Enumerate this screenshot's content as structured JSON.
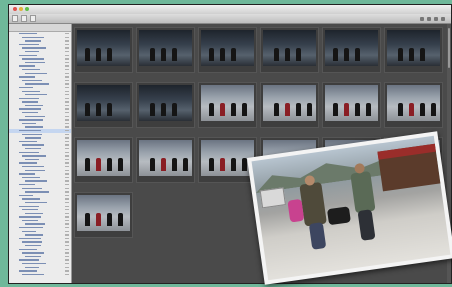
{
  "window": {
    "title": ""
  },
  "toolbar": {
    "buttons": [
      "",
      "",
      ""
    ]
  },
  "sidebar": {
    "header": "",
    "rows": 68,
    "selected_row": 27
  },
  "thumbnails": [
    {
      "kind": "dark",
      "caption": ""
    },
    {
      "kind": "dark",
      "caption": ""
    },
    {
      "kind": "dark",
      "caption": ""
    },
    {
      "kind": "dark",
      "caption": ""
    },
    {
      "kind": "dark",
      "caption": ""
    },
    {
      "kind": "dark",
      "caption": ""
    },
    {
      "kind": "dark",
      "caption": ""
    },
    {
      "kind": "dark",
      "caption": ""
    },
    {
      "kind": "street",
      "caption": ""
    },
    {
      "kind": "street",
      "caption": ""
    },
    {
      "kind": "street",
      "caption": ""
    },
    {
      "kind": "street",
      "caption": ""
    },
    {
      "kind": "street",
      "caption": ""
    },
    {
      "kind": "street",
      "caption": ""
    },
    {
      "kind": "street",
      "caption": ""
    },
    {
      "kind": "street",
      "caption": ""
    },
    {
      "kind": "street",
      "caption": ""
    },
    {
      "kind": "street",
      "caption": ""
    },
    {
      "kind": "street",
      "caption": ""
    }
  ],
  "colors": {
    "desktop": "#6fb89a",
    "content_bg": "#4a4a4a",
    "sidebar_bg": "#ececec",
    "selection": "#c5d6f0"
  },
  "icons": [
    "close-icon",
    "minimize-icon",
    "zoom-icon",
    "view-mode-icon",
    "sort-icon",
    "rotate-icon",
    "info-icon"
  ]
}
